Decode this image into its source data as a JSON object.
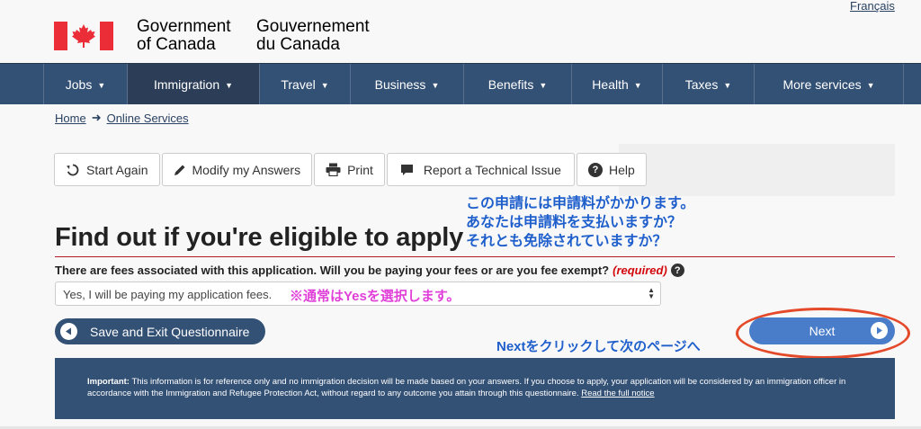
{
  "header": {
    "lang_link": "Français",
    "gov_en": "Government of Canada",
    "gov_fr": "Gouvernement du Canada"
  },
  "nav": {
    "items": [
      {
        "label": "Jobs",
        "icon": "chevron-down-icon"
      },
      {
        "label": "Immigration",
        "icon": "chevron-down-icon"
      },
      {
        "label": "Travel",
        "icon": "chevron-down-icon"
      },
      {
        "label": "Business",
        "icon": "chevron-down-icon"
      },
      {
        "label": "Benefits",
        "icon": "chevron-down-icon"
      },
      {
        "label": "Health",
        "icon": "chevron-down-icon"
      },
      {
        "label": "Taxes",
        "icon": "chevron-down-icon"
      },
      {
        "label": "More services",
        "icon": "chevron-down-icon"
      }
    ]
  },
  "breadcrumb": {
    "home": "Home",
    "separator": "➜",
    "current": "Online Services"
  },
  "toolbar": {
    "start_again": "Start Again",
    "modify_answers": "Modify my Answers",
    "print": "Print",
    "report_issue": "Report a Technical Issue",
    "help": "Help"
  },
  "annotations": {
    "fee_note_line1": "この申請には申請料がかかります。",
    "fee_note_line2": "あなたは申請料を支払いますか？",
    "fee_note_line3": "それとも免除されていますか？",
    "select_note": "※通常はYesを選択します。",
    "next_note": "Nextをクリックして次のページへ"
  },
  "main": {
    "title": "Find out if you're eligible to apply",
    "question": "There are fees associated with this application. Will you be paying your fees or are you fee exempt?",
    "required": "(required)",
    "help_glyph": "?",
    "select_value": "Yes, I will be paying my application fees.",
    "save_exit": "Save and Exit Questionnaire",
    "next": "Next"
  },
  "notice": {
    "label": "Important:",
    "text": "This information is for reference only and no immigration decision will be made based on your answers. If you choose to apply, your application will be considered by an immigration officer in accordance with the Immigration and Refugee Protection Act, without regard to any outcome you attain through this questionnaire.",
    "link": "Read the full notice"
  },
  "colors": {
    "nav_bg": "#335075",
    "nav_active": "#2c3e57",
    "flag_red": "#eb2d37",
    "annotation_blue": "#1f5fcc",
    "annotation_pink": "#e03fd8",
    "annotation_ring": "#e44a2a",
    "next_button": "#4a7dc9"
  }
}
